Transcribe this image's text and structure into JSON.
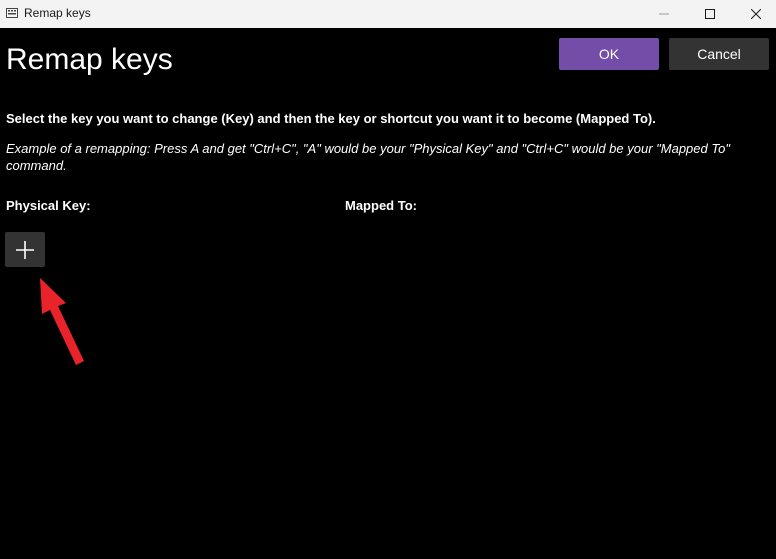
{
  "window": {
    "title": "Remap keys"
  },
  "header": {
    "heading": "Remap keys",
    "ok_label": "OK",
    "cancel_label": "Cancel"
  },
  "content": {
    "instructions": "Select the key you want to change (Key) and then the key or shortcut you want it to become (Mapped To).",
    "example": "Example of a remapping: Press A and get \"Ctrl+C\", \"A\" would be your \"Physical Key\" and \"Ctrl+C\" would be your \"Mapped To\" command.",
    "physical_key_label": "Physical Key:",
    "mapped_to_label": "Mapped To:"
  },
  "icons": {
    "app": "keyboard-icon",
    "minimize": "minimize-icon",
    "maximize": "maximize-icon",
    "close": "close-icon",
    "add": "plus-icon",
    "annotation": "arrow-icon"
  },
  "colors": {
    "background": "#000000",
    "titlebar": "#f3f3f3",
    "accent": "#744da9",
    "button": "#333333",
    "annotation_arrow": "#e8232a"
  }
}
